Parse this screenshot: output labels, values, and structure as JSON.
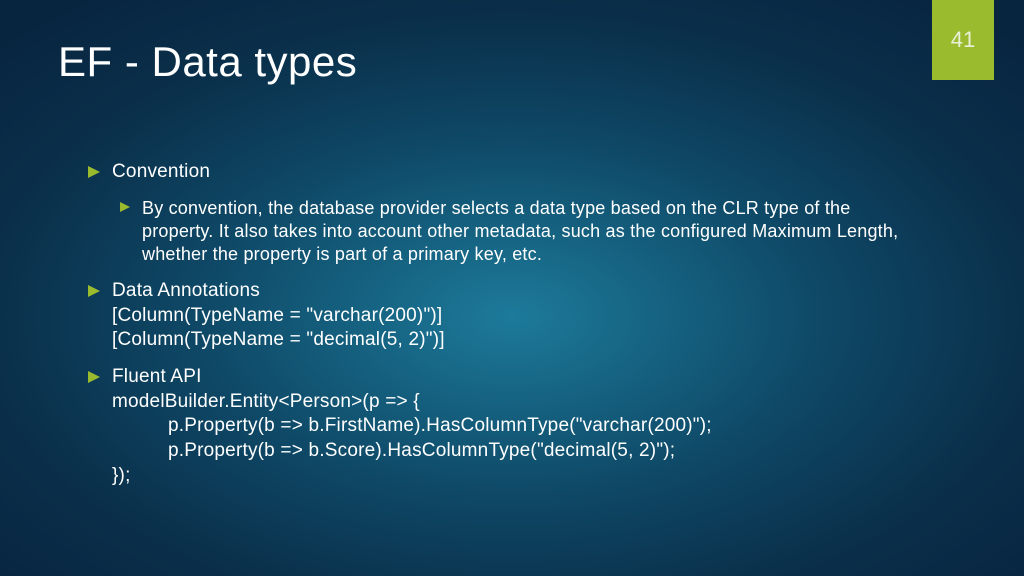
{
  "pageNumber": "41",
  "title": "EF - Data types",
  "bullets": {
    "b1": {
      "label": "Convention",
      "sub": "By convention, the database provider selects a data type based on the CLR type of the property. It also takes into account other metadata, such as the configured Maximum Length, whether the property is part of a primary key, etc."
    },
    "b2": {
      "line1": "Data Annotations",
      "line2": "[Column(TypeName = \"varchar(200)\")]",
      "line3": "[Column(TypeName = \"decimal(5, 2)\")]"
    },
    "b3": {
      "line1": "Fluent API",
      "line2": "modelBuilder.Entity<Person>(p => {",
      "line3": "p.Property(b => b.FirstName).HasColumnType(\"varchar(200)\");",
      "line4": "p.Property(b => b.Score).HasColumnType(\"decimal(5, 2)\");",
      "line5": "});"
    }
  },
  "colors": {
    "accent": "#9bbb2f"
  }
}
